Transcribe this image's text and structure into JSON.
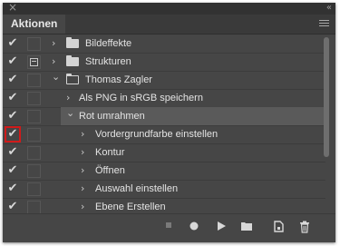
{
  "panel": {
    "tab_label": "Aktionen",
    "close_glyph": "×",
    "collapse_glyph": "«",
    "menu_icon": "hamburger-icon"
  },
  "rows": [
    {
      "label": "Bildeffekte",
      "checked": true,
      "dialog": false,
      "type": "set",
      "expanded": false
    },
    {
      "label": "Strukturen",
      "checked": true,
      "dialog": true,
      "type": "set",
      "expanded": false
    },
    {
      "label": "Thomas Zagler",
      "checked": true,
      "dialog": false,
      "type": "set",
      "expanded": true
    },
    {
      "label": "Als PNG in sRGB speichern",
      "checked": true,
      "dialog": false,
      "type": "action",
      "expanded": false
    },
    {
      "label": "Rot umrahmen",
      "checked": true,
      "dialog": false,
      "type": "action",
      "expanded": true,
      "selected": true
    },
    {
      "label": "Vordergrundfarbe einstellen",
      "checked": true,
      "dialog": false,
      "type": "command",
      "highlighted_check": true
    },
    {
      "label": "Kontur",
      "checked": true,
      "dialog": false,
      "type": "command"
    },
    {
      "label": "Öffnen",
      "checked": true,
      "dialog": false,
      "type": "command"
    },
    {
      "label": "Auswahl einstellen",
      "checked": true,
      "dialog": false,
      "type": "command"
    },
    {
      "label": "Ebene Erstellen",
      "checked": true,
      "dialog": false,
      "type": "command"
    }
  ],
  "glyphs": {
    "check": "✔",
    "chev_right": "›",
    "chev_down": "⌄"
  },
  "toolbar": [
    {
      "name": "stop-button",
      "icon": "stop-icon"
    },
    {
      "name": "record-button",
      "icon": "record-icon"
    },
    {
      "name": "play-button",
      "icon": "play-icon"
    },
    {
      "name": "new-set-button",
      "icon": "folder-icon"
    },
    {
      "name": "new-action-button",
      "icon": "new-page-icon"
    },
    {
      "name": "delete-button",
      "icon": "trash-icon"
    }
  ],
  "colors": {
    "panel_bg": "#464646",
    "selected_row": "#5a5a5a",
    "highlight_outline": "#d11a1a"
  }
}
